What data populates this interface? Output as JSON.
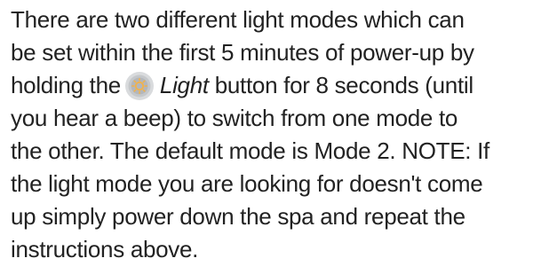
{
  "paragraph": {
    "line1": "There are two different light modes which can",
    "line2": "be set within the first 5 minutes of power-up by",
    "line3_before": "holding the",
    "line3_icon": "light-bulb-button-icon",
    "line3_emph": "Light",
    "line3_after": " button for 8 seconds (until",
    "line4": "you hear a beep) to switch from one mode to",
    "line5": "the other. The default mode is Mode 2. NOTE: If",
    "line6": "the light mode you are looking for doesn't come",
    "line7": "up simply power down the spa and repeat the",
    "line8": "instructions above."
  },
  "colors": {
    "text": "#222222",
    "icon_outer": "#d9dbdd",
    "icon_inner": "#b9bcbf",
    "icon_glyph": "#f2b24a"
  }
}
